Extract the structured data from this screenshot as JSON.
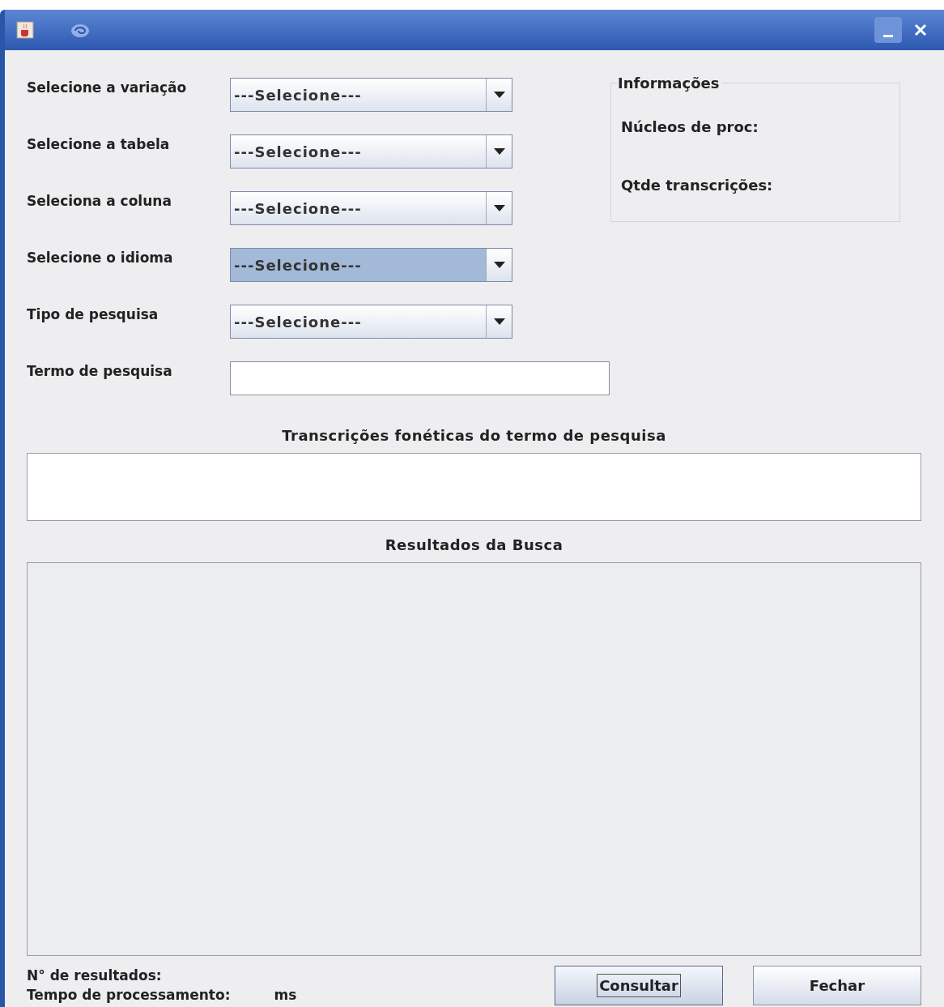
{
  "form": {
    "fields": [
      {
        "kind": "combo",
        "label": "Selecione a variação",
        "value": "---Selecione---",
        "focused": false
      },
      {
        "kind": "combo",
        "label": "Selecione a tabela",
        "value": "---Selecione---",
        "focused": false
      },
      {
        "kind": "combo",
        "label": "Seleciona a coluna",
        "value": "---Selecione---",
        "focused": false
      },
      {
        "kind": "combo",
        "label": "Selecione o idioma",
        "value": "---Selecione---",
        "focused": true
      },
      {
        "kind": "combo",
        "label": "Tipo de pesquisa",
        "value": "---Selecione---",
        "focused": false
      },
      {
        "kind": "text",
        "label": "Termo de pesquisa",
        "focused": false
      }
    ]
  },
  "info": {
    "title": "Informações",
    "lines": [
      "Núcleos de proc:",
      "Qtde transcrições:"
    ]
  },
  "transcriptions": {
    "title": "Transcrições fonéticas do termo de pesquisa"
  },
  "results": {
    "title": "Resultados da Busca"
  },
  "status": {
    "count_label": "N° de resultados:",
    "time_label": "Tempo de processamento:",
    "time_unit": "ms"
  },
  "buttons": [
    {
      "label": "Consultar",
      "focused": true
    },
    {
      "label": "Fechar",
      "focused": false
    }
  ]
}
